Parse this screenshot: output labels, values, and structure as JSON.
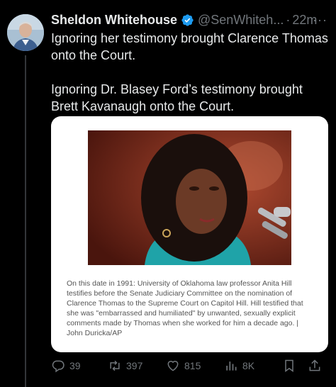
{
  "tweet": {
    "author_name": "Sheldon Whitehouse",
    "handle": "@SenWhiteh...",
    "separator": "·",
    "time": "22m",
    "more": "···",
    "text_line_1": "Ignoring her testimony brought Clarence Thomas onto the Court.",
    "text_line_2": "Ignoring Dr. Blasey Ford’s testimony brought Brett Kavanaugh onto the Court."
  },
  "card": {
    "caption": "On this date in 1991: University of Oklahoma law professor Anita Hill testifies before the Senate Judiciary Committee on the nomination of Clarence Thomas to the Supreme Court on Capitol Hill. Hill testified that she was \"embarrassed and humiliated\" by unwanted, sexually explicit comments made by Thomas when she worked for him a decade ago. | John Duricka/AP"
  },
  "actions": {
    "replies": "39",
    "reposts": "397",
    "likes": "815",
    "views": "8K"
  },
  "colors": {
    "background": "#000000",
    "text_primary": "#e7e9ea",
    "text_secondary": "#71767b",
    "verified_badge": "#1d9bf0"
  },
  "icons": [
    "verified-badge-icon",
    "more-icon",
    "reply-icon",
    "repost-icon",
    "like-icon",
    "views-icon",
    "bookmark-icon",
    "share-icon"
  ]
}
